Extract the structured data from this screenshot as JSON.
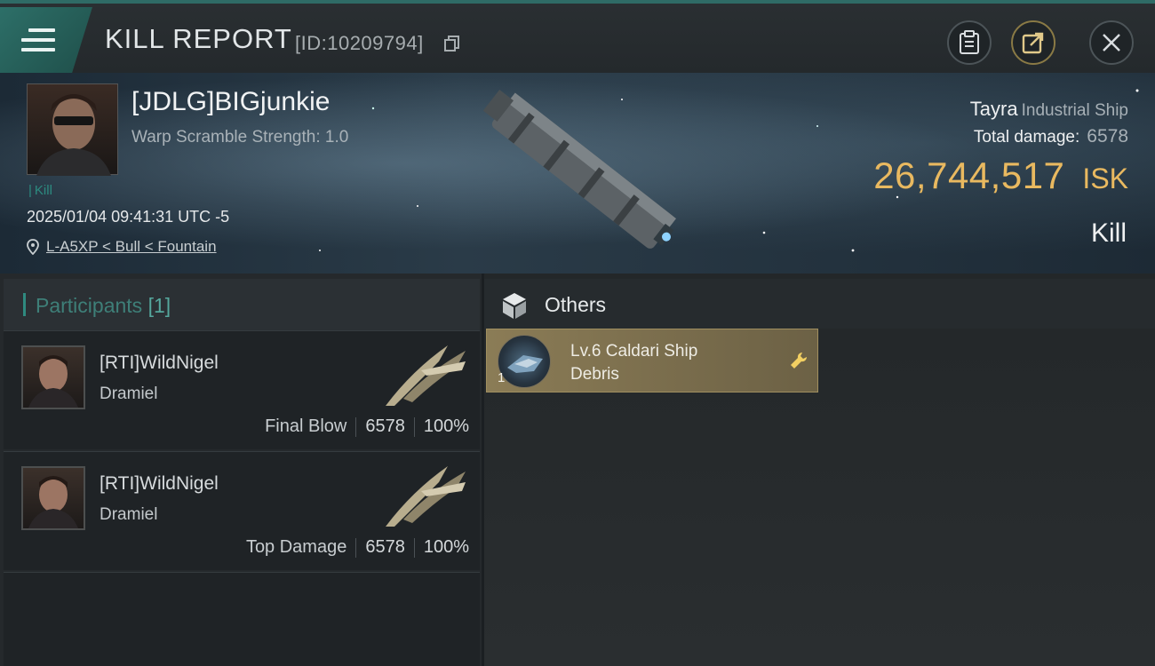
{
  "header": {
    "title": "KILL REPORT",
    "id_text": "[ID:10209794]",
    "icons": [
      "menu-icon",
      "copy-icon",
      "clipboard-icon",
      "share-icon",
      "close-icon"
    ]
  },
  "victim": {
    "name": "[JDLG]BIGjunkie",
    "warp_scramble": "Warp Scramble Strength: 1.0",
    "tag": "Kill",
    "datetime": "2025/01/04 09:41:31 UTC -5",
    "location": "L-A5XP < Bull < Fountain"
  },
  "ship": {
    "name": "Tayra",
    "class": "Industrial Ship",
    "total_damage_label": "Total damage:",
    "total_damage": "6578",
    "isk_value": "26,744,517",
    "isk_unit": "ISK",
    "result": "Kill"
  },
  "participants": {
    "title": "Participants",
    "count": "[1]",
    "rows": [
      {
        "name": "[RTI]WildNigel",
        "ship": "Dramiel",
        "role": "Final Blow",
        "damage": "6578",
        "percent": "100%"
      },
      {
        "name": "[RTI]WildNigel",
        "ship": "Dramiel",
        "role": "Top Damage",
        "damage": "6578",
        "percent": "100%"
      }
    ]
  },
  "others": {
    "title": "Others",
    "items": [
      {
        "qty": "1",
        "name_line1": "Lv.6 Caldari Ship",
        "name_line2": "Debris"
      }
    ]
  },
  "colors": {
    "accent_teal": "#2f8a7f",
    "isk_gold": "#e9b960",
    "item_gold": "#8b7c56"
  }
}
